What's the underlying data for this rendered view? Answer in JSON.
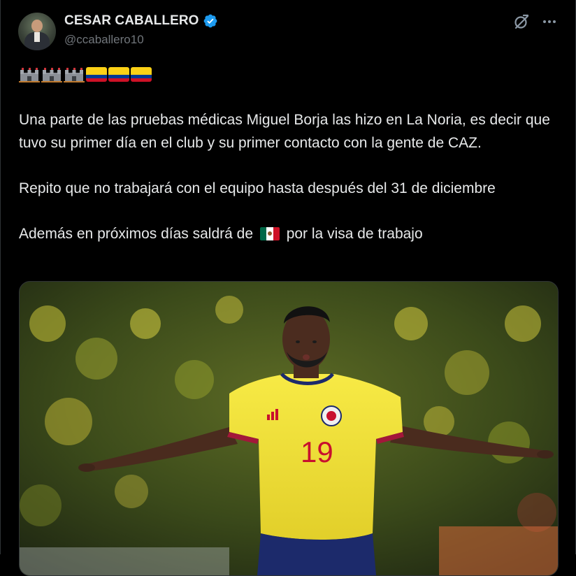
{
  "author": {
    "display_name": "CESAR CABALLERO",
    "handle": "@ccaballero10",
    "verified": true,
    "avatar_icon": "user-avatar"
  },
  "actions": {
    "grok_icon": "grok-icon",
    "more_icon": "more-options-icon"
  },
  "emoji_line": [
    "castle-emoji",
    "castle-emoji",
    "castle-emoji",
    "colombia-flag-emoji",
    "colombia-flag-emoji",
    "colombia-flag-emoji"
  ],
  "tweet": {
    "para1": "Una parte de las pruebas médicas Miguel Borja las hizo en La Noria, es decir que tuvo su primer día en el club y su primer contacto con la gente de CAZ.",
    "para2": "Repito que no trabajará con el equipo hasta después del 31 de diciembre",
    "para3_before": "Además en próximos días saldrá de",
    "para3_after": "por la visa de trabajo"
  },
  "media": {
    "jersey_number": "19",
    "jersey_logo": "adidas"
  },
  "colors": {
    "background": "#000000",
    "text": "#e7e9ea",
    "secondary_text": "#71767b",
    "verified_blue": "#1d9bf0",
    "jersey_yellow": "#f3e33a",
    "jersey_number_red": "#c8102e"
  }
}
